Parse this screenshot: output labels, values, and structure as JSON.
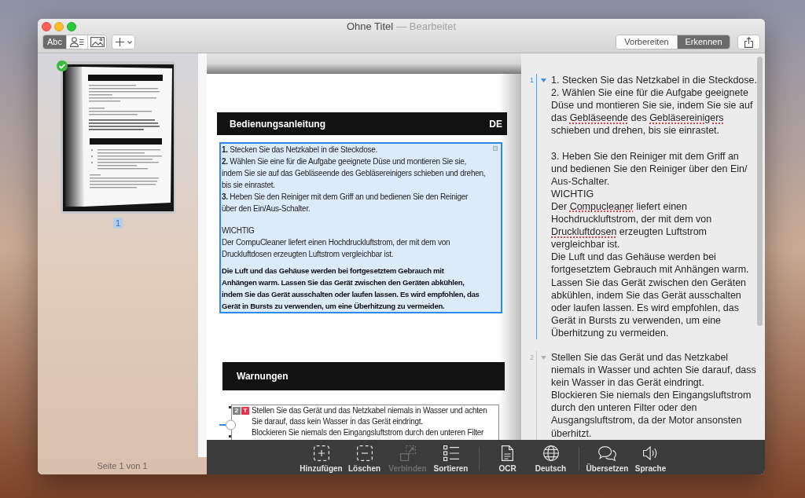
{
  "window": {
    "title": "Ohne Titel",
    "subtitle": "— Bearbeitet"
  },
  "toolbar": {
    "view_modes": [
      {
        "kind": "text",
        "label": "Abc",
        "selected": true
      },
      {
        "kind": "contact",
        "selected": false
      },
      {
        "kind": "image",
        "selected": false
      }
    ],
    "mode_tabs": [
      {
        "label": "Vorbereiten",
        "selected": false
      },
      {
        "label": "Erkennen",
        "selected": true
      }
    ]
  },
  "sidebar": {
    "pages": [
      {
        "label": "1",
        "selected": true,
        "recognized": true
      }
    ],
    "footer": "Seite 1 von 1"
  },
  "document": {
    "sections": [
      {
        "heading": "Bedienungsanleitung",
        "tag": "DE",
        "blocks": [
          {
            "selected": true,
            "paragraphs": [
              {
                "kind": "body",
                "text": "**1.** Stecken Sie das Netzkabel in die Steckdose.\n**2.** Wählen Sie eine für die Aufgabe geeignete Düse und montieren Sie sie,\nindem Sie sie auf das Gebläseende des Gebläsereinigers schieben und drehen,\nbis sie einrastet.\n**3.** Heben Sie den Reiniger mit dem Griff an und bedienen Sie den Reiniger\nüber den Ein/Aus-Schalter."
              },
              {
                "kind": "body",
                "text": "WICHTIG\nDer CompuCleaner liefert einen Hochdruckluftstrom, der mit dem von\nDruckluftdosen erzeugten Luftstrom vergleichbar ist."
              },
              {
                "kind": "bold",
                "text": "Die Luft und das Gehäuse werden bei fortgesetztem Gebrauch mit\nAnhängen warm. Lassen Sie das Gerät zwischen den Geräten abkühlen,\nindem Sie das Gerät ausschalten oder laufen lassen. Es wird empfohlen, das\nGerät in Bursts zu verwenden, um eine Überhitzung zu vermeiden."
              }
            ]
          }
        ]
      },
      {
        "heading": "Warnungen",
        "blocks": [
          {
            "selected": false,
            "number": "2",
            "type": "T",
            "paragraphs": [
              {
                "kind": "body",
                "text": "Stellen Sie das Gerät und das Netzkabel niemals in Wasser und achten\nSie darauf, dass kein Wasser in das Gerät eindringt.\nBlockieren Sie niemals den Eingangsluftstrom durch den unteren Filter"
              }
            ]
          }
        ]
      }
    ]
  },
  "recognized_text": {
    "blocks": [
      {
        "number": "1",
        "selected": true,
        "expanded": true,
        "runs": [
          {
            "text": "1. Stecken Sie das Netzkabel in die Steckdose.\n2. Wählen Sie eine für die Aufgabe geeignete\nDüse und montieren Sie sie, indem Sie sie auf\ndas ",
            "misspelled": false
          },
          {
            "text": "Gebläseende",
            "misspelled": true
          },
          {
            "text": " des ",
            "misspelled": false
          },
          {
            "text": "Gebläsereinigers",
            "misspelled": true
          },
          {
            "text": "\nschieben und drehen, bis sie einrastet.\n\n3. Heben Sie den Reiniger mit dem Griff an\nund bedienen Sie den Reiniger über den Ein/\nAus-Schalter.\nWICHTIG\nDer ",
            "misspelled": false
          },
          {
            "text": "Compucleaner",
            "misspelled": true
          },
          {
            "text": " liefert einen\nHochdruckluftstrom, der mit dem von\n",
            "misspelled": false
          },
          {
            "text": "Druckluftdosen",
            "misspelled": true
          },
          {
            "text": " erzeugten Luftstrom\nvergleichbar ist.\nDie Luft und das Gehäuse werden bei\nfortgesetztem Gebrauch mit Anhängen warm.\nLassen Sie das Gerät zwischen den Geräten\nabkühlen, indem Sie das Gerät ausschalten\noder laufen lassen. Es wird empfohlen, das\nGerät in Bursts zu verwenden, um eine\nÜberhitzung zu vermeiden.",
            "misspelled": false
          }
        ]
      },
      {
        "number": "2",
        "selected": false,
        "expanded": true,
        "runs": [
          {
            "text": "Stellen Sie das Gerät und das Netzkabel\nniemals in Wasser und achten Sie darauf, dass\nkein Wasser in das Gerät eindringt.\nBlockieren Sie niemals den Eingangsluftstrom\ndurch den unteren Filter oder den\nAusgangsluftstrom, da der Motor ansonsten\nüberhitzt.",
            "misspelled": false
          }
        ]
      }
    ]
  },
  "actions": {
    "groups": [
      {
        "items": [
          {
            "kind": "add",
            "label": "Hinzufügen",
            "disabled": false
          },
          {
            "kind": "delete",
            "label": "Löschen",
            "disabled": false
          },
          {
            "kind": "merge",
            "label": "Verbinden",
            "disabled": true
          },
          {
            "kind": "sort",
            "label": "Sortieren",
            "disabled": false
          }
        ]
      },
      {
        "items": [
          {
            "kind": "ocr",
            "label": "OCR",
            "disabled": false
          },
          {
            "kind": "language",
            "label": "Deutsch",
            "disabled": false
          }
        ]
      },
      {
        "items": [
          {
            "kind": "translate",
            "label": "Übersetzen",
            "disabled": false
          },
          {
            "kind": "speech",
            "label": "Sprache",
            "disabled": false
          }
        ]
      }
    ]
  }
}
